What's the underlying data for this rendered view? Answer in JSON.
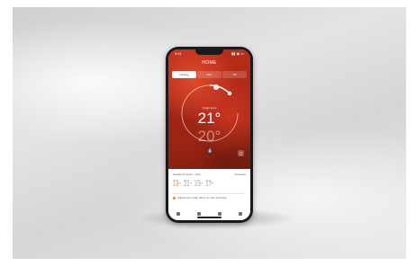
{
  "app": {
    "title": "HOME",
    "status_time": "9:41",
    "status_icons": "▮▮ ◉ ▭"
  },
  "tabs": [
    {
      "label": "Heating"
    },
    {
      "label": "Eco"
    },
    {
      "label": "Off"
    }
  ],
  "thermostat": {
    "target_label": "Target temp",
    "target_temp": "21°",
    "current_temp": "20°",
    "drop_icon": "drop-icon",
    "corner_icon": "▢"
  },
  "schedule": {
    "header_left": "Weekly Program • Now",
    "header_right": "Schedule",
    "slots": [
      {
        "label": "06:00",
        "temp": "19°",
        "style": "accent"
      },
      {
        "label": "08:00",
        "temp": "21°",
        "style": "gray"
      },
      {
        "label": "17:00",
        "temp": "23°",
        "style": "gray"
      },
      {
        "label": "22:00",
        "temp": "17°",
        "style": "gray"
      }
    ],
    "info": "Adjustments take effect on next schedule"
  },
  "colors": {
    "accent": "#e3863a",
    "hero": "#b92d18"
  }
}
